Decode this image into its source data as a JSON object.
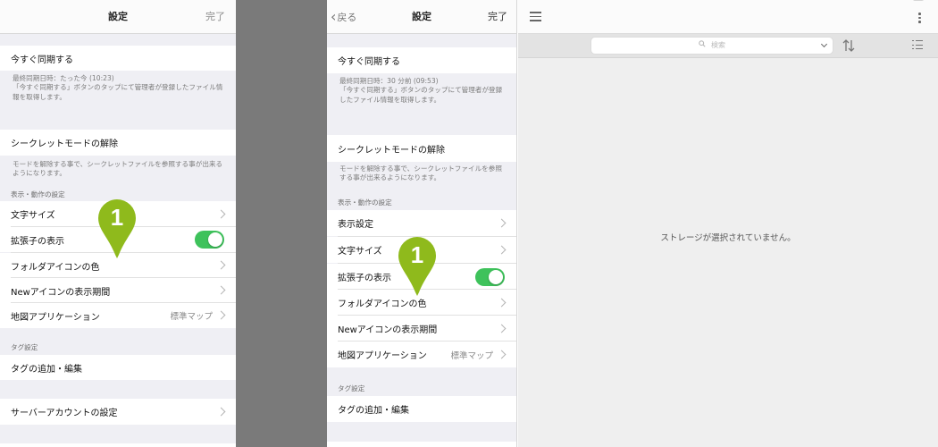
{
  "left": {
    "nav": {
      "title": "設定",
      "done": "完了"
    },
    "sync_now": "今すぐ同期する",
    "sync_note": "最終同期日時：たった今 (10:23)\n「今すぐ同期する」ボタンのタップにて管理者が登録したファイル情報を取得します。",
    "secret_unlock": "シークレットモードの解除",
    "secret_note": "モードを解除する事で、シークレットファイルを参照する事が出来るようになります。",
    "display_section": "表示・動作の設定",
    "font_size": "文字サイズ",
    "show_extension": "拡張子の表示",
    "show_extension_on": true,
    "folder_icon_color": "フォルダアイコンの色",
    "new_icon_period": "Newアイコンの表示期間",
    "map_app": "地図アプリケーション",
    "map_app_value": "標準マップ",
    "tag_section": "タグ設定",
    "tag_add_edit": "タグの追加・編集",
    "server_account": "サーバーアカウントの設定",
    "marker_number": "1"
  },
  "mid": {
    "nav": {
      "back": "戻る",
      "title": "設定",
      "done": "完了"
    },
    "sync_now": "今すぐ同期する",
    "sync_note": "最終同期日時：30 分前 (09:53)\n「今すぐ同期する」ボタンのタップにて管理者が登録したファイル情報を取得します。",
    "secret_unlock": "シークレットモードの解除",
    "secret_note": "モードを解除する事で、シークレットファイルを参照する事が出来るようになります。",
    "display_section": "表示・動作の設定",
    "display_settings": "表示設定",
    "font_size": "文字サイズ",
    "show_extension": "拡張子の表示",
    "show_extension_on": true,
    "folder_icon_color": "フォルダアイコンの色",
    "new_icon_period": "Newアイコンの表示期間",
    "map_app": "地図アプリケーション",
    "map_app_value": "標準マップ",
    "tag_section": "タグ設定",
    "tag_add_edit": "タグの追加・編集",
    "marker_number": "1"
  },
  "right": {
    "search_placeholder": "検索",
    "empty_message": "ストレージが選択されていません。"
  },
  "colors": {
    "toggle_on": "#3ec25b",
    "marker": "#8fba1c",
    "divider": "#7a7a7a"
  },
  "icons": [
    "menu-icon",
    "more-icon",
    "search-icon",
    "sort-icon",
    "list-view-icon",
    "chevron-right-icon",
    "chevron-left-icon"
  ]
}
